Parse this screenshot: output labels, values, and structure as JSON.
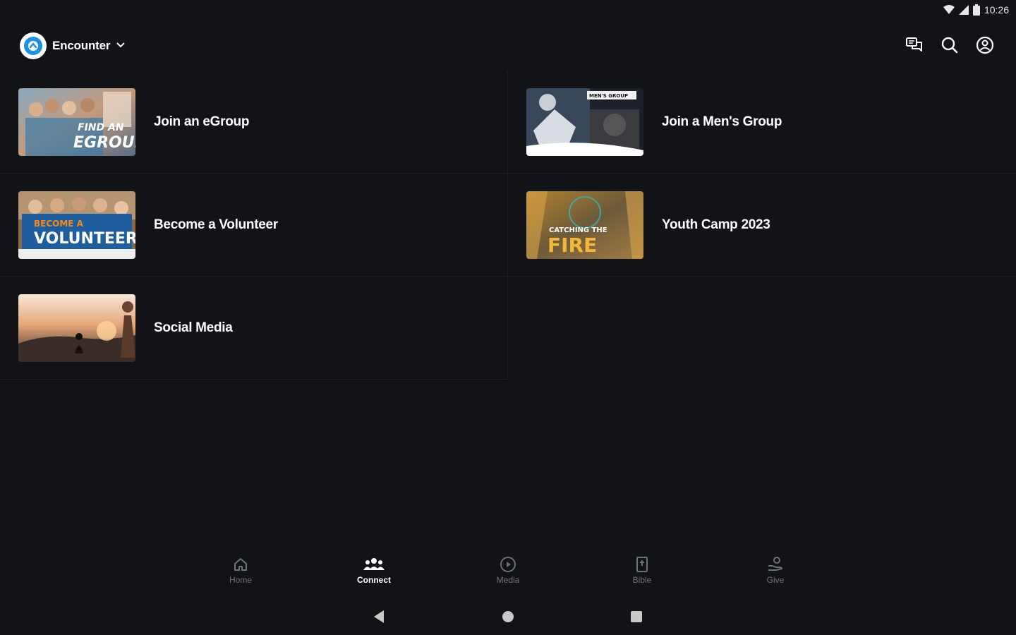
{
  "status_bar": {
    "time": "10:26"
  },
  "app_bar": {
    "org_name": "Encounter",
    "actions": [
      "chat-icon",
      "search-icon",
      "account-icon"
    ]
  },
  "items": [
    {
      "label": "Join an eGroup",
      "thumb_text": [
        "FIND AN",
        "EGROUP"
      ]
    },
    {
      "label": "Join a Men's Group",
      "thumb_text": [
        "MEN'S GROUP"
      ]
    },
    {
      "label": "Become a Volunteer",
      "thumb_text": [
        "BECOME A",
        "VOLUNTEER"
      ]
    },
    {
      "label": "Youth Camp 2023",
      "thumb_text": [
        "CATCHING THE",
        "FIRE"
      ]
    },
    {
      "label": "Social Media",
      "thumb_text": []
    }
  ],
  "bottom_nav": {
    "active": "Connect",
    "items": [
      {
        "label": "Home",
        "icon": "home-icon"
      },
      {
        "label": "Connect",
        "icon": "group-icon"
      },
      {
        "label": "Media",
        "icon": "play-icon"
      },
      {
        "label": "Bible",
        "icon": "bible-icon"
      },
      {
        "label": "Give",
        "icon": "give-icon"
      }
    ]
  },
  "colors": {
    "background": "#121316",
    "accent": "#1e8fe1",
    "inactive": "#6f7278"
  }
}
